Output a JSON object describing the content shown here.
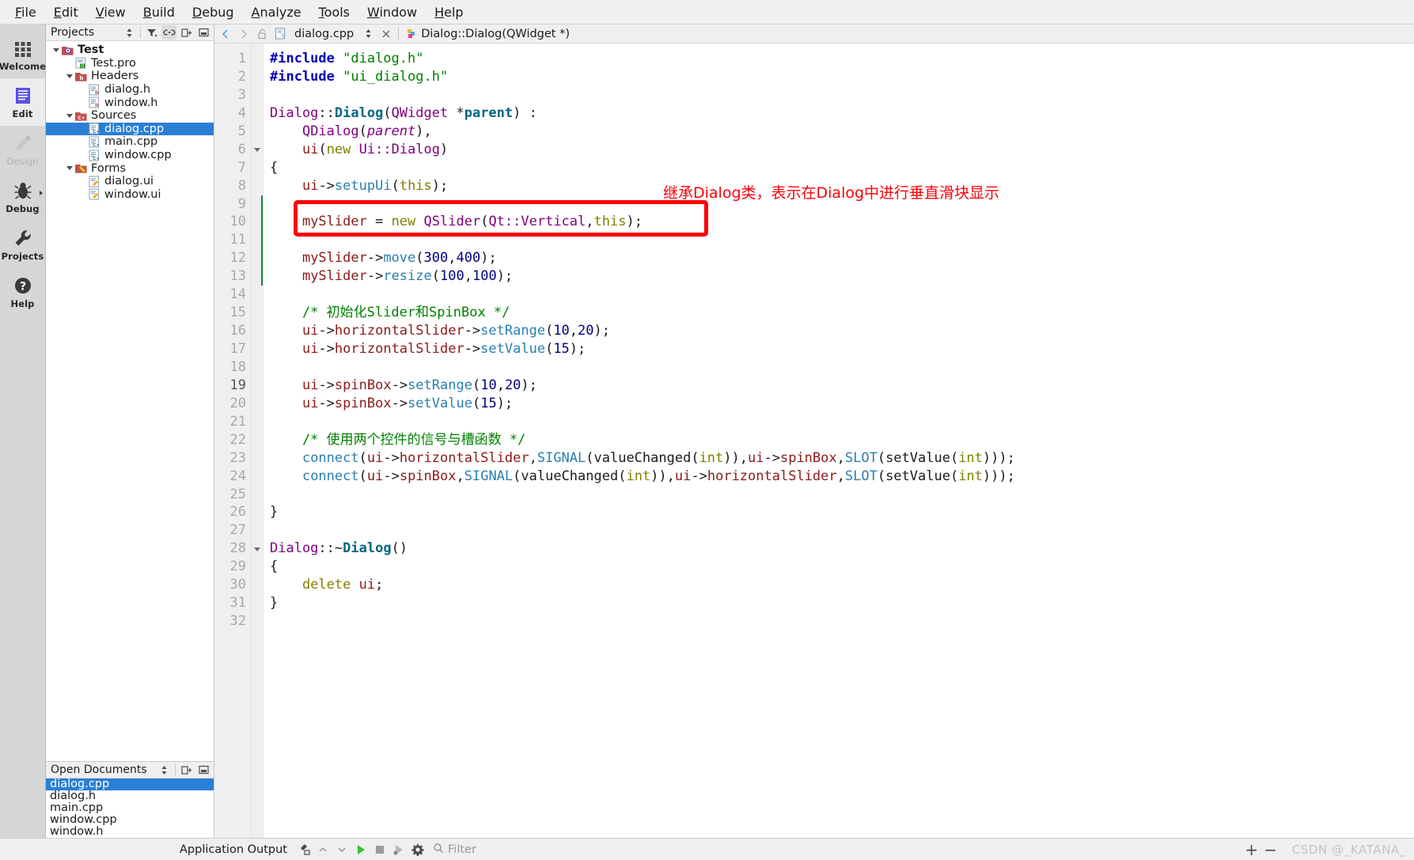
{
  "menubar": {
    "items": [
      {
        "label": "File",
        "mnemonic": "F"
      },
      {
        "label": "Edit",
        "mnemonic": "E"
      },
      {
        "label": "View",
        "mnemonic": "V"
      },
      {
        "label": "Build",
        "mnemonic": "B"
      },
      {
        "label": "Debug",
        "mnemonic": "D"
      },
      {
        "label": "Analyze",
        "mnemonic": "A"
      },
      {
        "label": "Tools",
        "mnemonic": "T"
      },
      {
        "label": "Window",
        "mnemonic": "W"
      },
      {
        "label": "Help",
        "mnemonic": "H"
      }
    ]
  },
  "modebar": {
    "items": [
      {
        "label": "Welcome",
        "icon": "grid-icon",
        "state": "normal"
      },
      {
        "label": "Edit",
        "icon": "document-lines-icon",
        "state": "active"
      },
      {
        "label": "Design",
        "icon": "pencil-icon",
        "state": "disabled"
      },
      {
        "label": "Debug",
        "icon": "bug-icon",
        "state": "normal"
      },
      {
        "label": "Projects",
        "icon": "wrench-icon",
        "state": "normal"
      },
      {
        "label": "Help",
        "icon": "question-circle-icon",
        "state": "normal"
      }
    ]
  },
  "projects_panel": {
    "title": "Projects",
    "toolbar": [
      {
        "name": "sync-selector",
        "icon": "updown-arrows-icon"
      },
      {
        "name": "filter-button",
        "icon": "filter-icon"
      },
      {
        "name": "link-with-editor-button",
        "icon": "link-icon",
        "active": true
      },
      {
        "name": "split-button",
        "icon": "split-icon"
      },
      {
        "name": "close-button",
        "icon": "minimize-icon"
      }
    ],
    "tree": [
      {
        "label": "Test",
        "depth": 0,
        "icon": "project-icon",
        "expandable": true,
        "bold": true,
        "selected": false
      },
      {
        "label": "Test.pro",
        "depth": 1,
        "icon": "pro-file-icon",
        "expandable": false,
        "bold": false,
        "selected": false
      },
      {
        "label": "Headers",
        "depth": 1,
        "icon": "folder-h-icon",
        "expandable": true,
        "bold": false,
        "selected": false
      },
      {
        "label": "dialog.h",
        "depth": 2,
        "icon": "header-file-icon",
        "expandable": false,
        "bold": false,
        "selected": false
      },
      {
        "label": "window.h",
        "depth": 2,
        "icon": "header-file-icon",
        "expandable": false,
        "bold": false,
        "selected": false
      },
      {
        "label": "Sources",
        "depth": 1,
        "icon": "folder-cpp-icon",
        "expandable": true,
        "bold": false,
        "selected": false
      },
      {
        "label": "dialog.cpp",
        "depth": 2,
        "icon": "cpp-file-icon",
        "expandable": false,
        "bold": false,
        "selected": true
      },
      {
        "label": "main.cpp",
        "depth": 2,
        "icon": "cpp-file-icon",
        "expandable": false,
        "bold": false,
        "selected": false
      },
      {
        "label": "window.cpp",
        "depth": 2,
        "icon": "cpp-file-icon",
        "expandable": false,
        "bold": false,
        "selected": false
      },
      {
        "label": "Forms",
        "depth": 1,
        "icon": "folder-ui-icon",
        "expandable": true,
        "bold": false,
        "selected": false
      },
      {
        "label": "dialog.ui",
        "depth": 2,
        "icon": "ui-file-icon",
        "expandable": false,
        "bold": false,
        "selected": false
      },
      {
        "label": "window.ui",
        "depth": 2,
        "icon": "ui-file-icon",
        "expandable": false,
        "bold": false,
        "selected": false
      }
    ]
  },
  "open_documents": {
    "title": "Open Documents",
    "toolbar": [
      {
        "name": "sort-selector",
        "icon": "updown-arrows-icon"
      },
      {
        "name": "split-button",
        "icon": "split-icon"
      },
      {
        "name": "close-button",
        "icon": "minimize-icon"
      }
    ],
    "items": [
      {
        "label": "dialog.cpp",
        "selected": true
      },
      {
        "label": "dialog.h",
        "selected": false
      },
      {
        "label": "main.cpp",
        "selected": false
      },
      {
        "label": "window.cpp",
        "selected": false
      },
      {
        "label": "window.h",
        "selected": false
      }
    ]
  },
  "editor": {
    "tabbar": {
      "back_icon": "chevron-left-icon",
      "forward_icon": "chevron-right-icon",
      "lock_icon": "unlocked-icon",
      "file_icon": "cpp-file-icon",
      "filename": "dialog.cpp",
      "selector_icon": "updown-arrows-icon",
      "close_icon": "close-icon",
      "symbol_icon": "qt-symbol-icon",
      "symbol": "Dialog::Dialog(QWidget *)",
      "split_icon": "minimize-icon"
    },
    "cursor_line": 19,
    "current_block_lines": [
      9,
      10,
      11,
      12,
      13
    ],
    "fold_markers": [
      6,
      28
    ],
    "total_lines": 32,
    "lines": [
      {
        "n": 1,
        "tokens": [
          {
            "t": "#include ",
            "c": "k-pre"
          },
          {
            "t": "\"dialog.h\"",
            "c": "k-str"
          }
        ]
      },
      {
        "n": 2,
        "tokens": [
          {
            "t": "#include ",
            "c": "k-pre"
          },
          {
            "t": "\"ui_dialog.h\"",
            "c": "k-str"
          }
        ]
      },
      {
        "n": 3,
        "tokens": []
      },
      {
        "n": 4,
        "tokens": [
          {
            "t": "Dialog",
            "c": "k-cls"
          },
          {
            "t": "::",
            "c": "k-plain"
          },
          {
            "t": "Dialog",
            "c": "k-ctor"
          },
          {
            "t": "(",
            "c": "k-plain"
          },
          {
            "t": "QWidget",
            "c": "k-cls"
          },
          {
            "t": " *",
            "c": "k-plain"
          },
          {
            "t": "parent",
            "c": "k-ctor"
          },
          {
            "t": ") :",
            "c": "k-plain"
          }
        ]
      },
      {
        "n": 5,
        "tokens": [
          {
            "t": "    ",
            "c": "k-plain"
          },
          {
            "t": "QDialog",
            "c": "k-cls"
          },
          {
            "t": "(",
            "c": "k-plain"
          },
          {
            "t": "parent",
            "c": "k-param"
          },
          {
            "t": "),",
            "c": "k-plain"
          }
        ]
      },
      {
        "n": 6,
        "tokens": [
          {
            "t": "    ",
            "c": "k-plain"
          },
          {
            "t": "ui",
            "c": "k-fld"
          },
          {
            "t": "(",
            "c": "k-plain"
          },
          {
            "t": "new",
            "c": "k-kw"
          },
          {
            "t": " ",
            "c": "k-plain"
          },
          {
            "t": "Ui::Dialog",
            "c": "k-cls"
          },
          {
            "t": ")",
            "c": "k-plain"
          }
        ]
      },
      {
        "n": 7,
        "tokens": [
          {
            "t": "{",
            "c": "k-plain"
          }
        ]
      },
      {
        "n": 8,
        "tokens": [
          {
            "t": "    ",
            "c": "k-plain"
          },
          {
            "t": "ui",
            "c": "k-fld"
          },
          {
            "t": "->",
            "c": "k-plain"
          },
          {
            "t": "setupUi",
            "c": "k-fn"
          },
          {
            "t": "(",
            "c": "k-plain"
          },
          {
            "t": "this",
            "c": "k-kw"
          },
          {
            "t": ");",
            "c": "k-plain"
          }
        ]
      },
      {
        "n": 9,
        "tokens": []
      },
      {
        "n": 10,
        "tokens": [
          {
            "t": "    ",
            "c": "k-plain"
          },
          {
            "t": "mySlider",
            "c": "k-fld"
          },
          {
            "t": " = ",
            "c": "k-plain"
          },
          {
            "t": "new",
            "c": "k-kw"
          },
          {
            "t": " ",
            "c": "k-plain"
          },
          {
            "t": "QSlider",
            "c": "k-cls"
          },
          {
            "t": "(",
            "c": "k-plain"
          },
          {
            "t": "Qt::Vertical",
            "c": "k-cls"
          },
          {
            "t": ",",
            "c": "k-plain"
          },
          {
            "t": "this",
            "c": "k-kw"
          },
          {
            "t": ");",
            "c": "k-plain"
          }
        ]
      },
      {
        "n": 11,
        "tokens": []
      },
      {
        "n": 12,
        "tokens": [
          {
            "t": "    ",
            "c": "k-plain"
          },
          {
            "t": "mySlider",
            "c": "k-fld"
          },
          {
            "t": "->",
            "c": "k-plain"
          },
          {
            "t": "move",
            "c": "k-fn"
          },
          {
            "t": "(",
            "c": "k-plain"
          },
          {
            "t": "300",
            "c": "k-num"
          },
          {
            "t": ",",
            "c": "k-plain"
          },
          {
            "t": "400",
            "c": "k-num"
          },
          {
            "t": ");",
            "c": "k-plain"
          }
        ]
      },
      {
        "n": 13,
        "tokens": [
          {
            "t": "    ",
            "c": "k-plain"
          },
          {
            "t": "mySlider",
            "c": "k-fld"
          },
          {
            "t": "->",
            "c": "k-plain"
          },
          {
            "t": "resize",
            "c": "k-fn"
          },
          {
            "t": "(",
            "c": "k-plain"
          },
          {
            "t": "100",
            "c": "k-num"
          },
          {
            "t": ",",
            "c": "k-plain"
          },
          {
            "t": "100",
            "c": "k-num"
          },
          {
            "t": ");",
            "c": "k-plain"
          }
        ]
      },
      {
        "n": 14,
        "tokens": []
      },
      {
        "n": 15,
        "tokens": [
          {
            "t": "    /* 初始化Slider和SpinBox */",
            "c": "k-cmt"
          }
        ]
      },
      {
        "n": 16,
        "tokens": [
          {
            "t": "    ",
            "c": "k-plain"
          },
          {
            "t": "ui",
            "c": "k-fld"
          },
          {
            "t": "->",
            "c": "k-plain"
          },
          {
            "t": "horizontalSlider",
            "c": "k-fld"
          },
          {
            "t": "->",
            "c": "k-plain"
          },
          {
            "t": "setRange",
            "c": "k-fn"
          },
          {
            "t": "(",
            "c": "k-plain"
          },
          {
            "t": "10",
            "c": "k-num"
          },
          {
            "t": ",",
            "c": "k-plain"
          },
          {
            "t": "20",
            "c": "k-num"
          },
          {
            "t": ");",
            "c": "k-plain"
          }
        ]
      },
      {
        "n": 17,
        "tokens": [
          {
            "t": "    ",
            "c": "k-plain"
          },
          {
            "t": "ui",
            "c": "k-fld"
          },
          {
            "t": "->",
            "c": "k-plain"
          },
          {
            "t": "horizontalSlider",
            "c": "k-fld"
          },
          {
            "t": "->",
            "c": "k-plain"
          },
          {
            "t": "setValue",
            "c": "k-fn"
          },
          {
            "t": "(",
            "c": "k-plain"
          },
          {
            "t": "15",
            "c": "k-num"
          },
          {
            "t": ");",
            "c": "k-plain"
          }
        ]
      },
      {
        "n": 18,
        "tokens": []
      },
      {
        "n": 19,
        "tokens": [
          {
            "t": "    ",
            "c": "k-plain"
          },
          {
            "t": "ui",
            "c": "k-fld"
          },
          {
            "t": "->",
            "c": "k-plain"
          },
          {
            "t": "spinBox",
            "c": "k-fld"
          },
          {
            "t": "->",
            "c": "k-plain"
          },
          {
            "t": "setRange",
            "c": "k-fn"
          },
          {
            "t": "(",
            "c": "k-plain"
          },
          {
            "t": "10",
            "c": "k-num"
          },
          {
            "t": ",",
            "c": "k-plain"
          },
          {
            "t": "20",
            "c": "k-num"
          },
          {
            "t": ");",
            "c": "k-plain"
          }
        ]
      },
      {
        "n": 20,
        "tokens": [
          {
            "t": "    ",
            "c": "k-plain"
          },
          {
            "t": "ui",
            "c": "k-fld"
          },
          {
            "t": "->",
            "c": "k-plain"
          },
          {
            "t": "spinBox",
            "c": "k-fld"
          },
          {
            "t": "->",
            "c": "k-plain"
          },
          {
            "t": "setValue",
            "c": "k-fn"
          },
          {
            "t": "(",
            "c": "k-plain"
          },
          {
            "t": "15",
            "c": "k-num"
          },
          {
            "t": ");",
            "c": "k-plain"
          }
        ]
      },
      {
        "n": 21,
        "tokens": []
      },
      {
        "n": 22,
        "tokens": [
          {
            "t": "    /* 使用两个控件的信号与槽函数 */",
            "c": "k-cmt"
          }
        ]
      },
      {
        "n": 23,
        "tokens": [
          {
            "t": "    ",
            "c": "k-plain"
          },
          {
            "t": "connect",
            "c": "k-fn"
          },
          {
            "t": "(",
            "c": "k-plain"
          },
          {
            "t": "ui",
            "c": "k-fld"
          },
          {
            "t": "->",
            "c": "k-plain"
          },
          {
            "t": "horizontalSlider",
            "c": "k-fld"
          },
          {
            "t": ",",
            "c": "k-plain"
          },
          {
            "t": "SIGNAL",
            "c": "k-macro"
          },
          {
            "t": "(valueChanged(",
            "c": "k-plain"
          },
          {
            "t": "int",
            "c": "k-kw"
          },
          {
            "t": ")),",
            "c": "k-plain"
          },
          {
            "t": "ui",
            "c": "k-fld"
          },
          {
            "t": "->",
            "c": "k-plain"
          },
          {
            "t": "spinBox",
            "c": "k-fld"
          },
          {
            "t": ",",
            "c": "k-plain"
          },
          {
            "t": "SLOT",
            "c": "k-macro"
          },
          {
            "t": "(setValue(",
            "c": "k-plain"
          },
          {
            "t": "int",
            "c": "k-kw"
          },
          {
            "t": ")));",
            "c": "k-plain"
          }
        ]
      },
      {
        "n": 24,
        "tokens": [
          {
            "t": "    ",
            "c": "k-plain"
          },
          {
            "t": "connect",
            "c": "k-fn"
          },
          {
            "t": "(",
            "c": "k-plain"
          },
          {
            "t": "ui",
            "c": "k-fld"
          },
          {
            "t": "->",
            "c": "k-plain"
          },
          {
            "t": "spinBox",
            "c": "k-fld"
          },
          {
            "t": ",",
            "c": "k-plain"
          },
          {
            "t": "SIGNAL",
            "c": "k-macro"
          },
          {
            "t": "(valueChanged(",
            "c": "k-plain"
          },
          {
            "t": "int",
            "c": "k-kw"
          },
          {
            "t": ")),",
            "c": "k-plain"
          },
          {
            "t": "ui",
            "c": "k-fld"
          },
          {
            "t": "->",
            "c": "k-plain"
          },
          {
            "t": "horizontalSlider",
            "c": "k-fld"
          },
          {
            "t": ",",
            "c": "k-plain"
          },
          {
            "t": "SLOT",
            "c": "k-macro"
          },
          {
            "t": "(setValue(",
            "c": "k-plain"
          },
          {
            "t": "int",
            "c": "k-kw"
          },
          {
            "t": ")));",
            "c": "k-plain"
          }
        ]
      },
      {
        "n": 25,
        "tokens": []
      },
      {
        "n": 26,
        "tokens": [
          {
            "t": "}",
            "c": "k-plain"
          }
        ]
      },
      {
        "n": 27,
        "tokens": []
      },
      {
        "n": 28,
        "tokens": [
          {
            "t": "Dialog",
            "c": "k-cls"
          },
          {
            "t": "::~",
            "c": "k-plain"
          },
          {
            "t": "Dialog",
            "c": "k-ctor"
          },
          {
            "t": "()",
            "c": "k-plain"
          }
        ]
      },
      {
        "n": 29,
        "tokens": [
          {
            "t": "{",
            "c": "k-plain"
          }
        ]
      },
      {
        "n": 30,
        "tokens": [
          {
            "t": "    ",
            "c": "k-plain"
          },
          {
            "t": "delete",
            "c": "k-kw"
          },
          {
            "t": " ",
            "c": "k-plain"
          },
          {
            "t": "ui",
            "c": "k-fld"
          },
          {
            "t": ";",
            "c": "k-plain"
          }
        ]
      },
      {
        "n": 31,
        "tokens": [
          {
            "t": "}",
            "c": "k-plain"
          }
        ]
      },
      {
        "n": 32,
        "tokens": []
      }
    ]
  },
  "annotation": {
    "text": "继承Dialog类，表示在Dialog中进行垂直滑块显示",
    "color": "#fb0007",
    "highlight_box_color": "#fb0007",
    "highlighted_line": 10
  },
  "statusbar": {
    "title": "Application Output",
    "buttons": [
      {
        "name": "clear-output-button",
        "icon": "broom-icon"
      },
      {
        "name": "prev-item-button",
        "icon": "chevron-up-icon"
      },
      {
        "name": "next-item-button",
        "icon": "chevron-down-icon"
      },
      {
        "name": "run-button",
        "icon": "play-icon"
      },
      {
        "name": "stop-button",
        "icon": "stop-icon"
      },
      {
        "name": "attach-debugger-button",
        "icon": "debug-attach-icon"
      },
      {
        "name": "settings-button",
        "icon": "gear-icon"
      }
    ],
    "filter_placeholder": "Filter",
    "filter_icon": "search-icon",
    "zoom_in": "+",
    "zoom_out": "−"
  },
  "watermark": "CSDN @_KATANA_"
}
